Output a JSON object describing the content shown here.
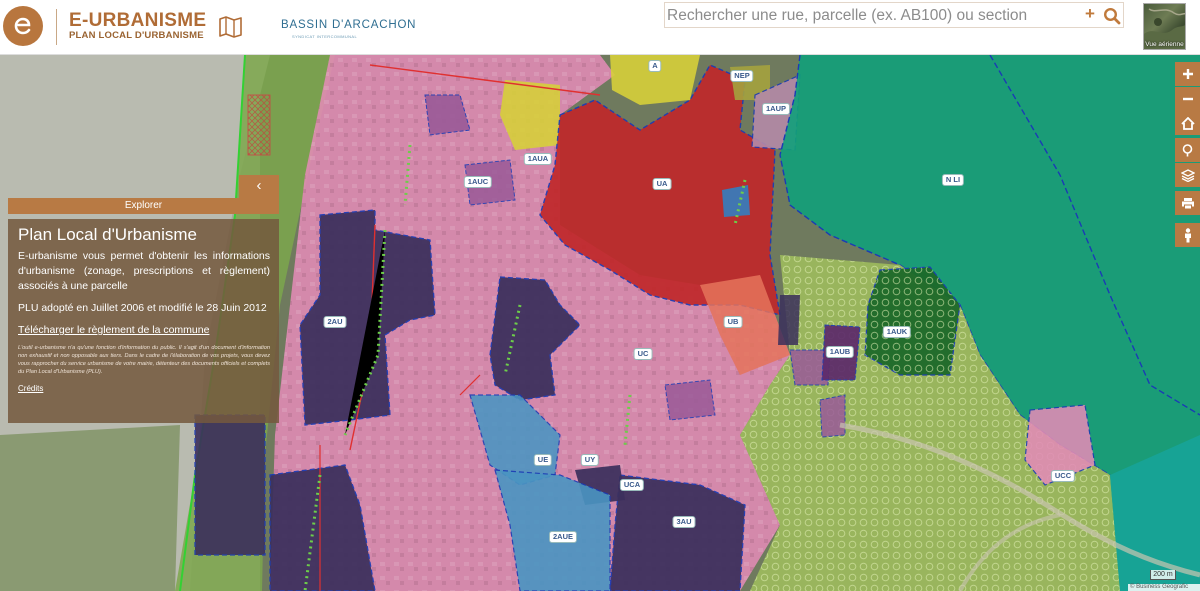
{
  "header": {
    "brand_title": "E-URBANISME",
    "brand_subtitle": "PLAN LOCAL D'URBANISME",
    "partner_name": "BASSIN D'ARCACHON",
    "partner_tagline": "SYNDICAT INTERCOMMUNAL",
    "search_placeholder": "Rechercher une rue, parcelle (ex. AB100) ou section",
    "search_plus": "+",
    "aerial_label": "Vue aérienne"
  },
  "panel": {
    "tab_label": "Explorer",
    "toggle_glyph": "‹",
    "title": "Plan Local d'Urbanisme",
    "description": "E-urbanisme vous permet d'obtenir les informations d'urbanisme (zonage, prescriptions et règlement) associés à une parcelle",
    "dates": "PLU adopté en Juillet 2006 et modifié le 28 Juin 2012",
    "download_link": "Télécharger le règlement de la commune",
    "disclaimer": "L'outil e-urbanisme n'a qu'une fonction d'information du public. Il s'agit d'un document d'information non exhaustif et non opposable aux tiers. Dans le cadre de l'élaboration de vos projets, vous devez vous rapprocher du service urbanisme de votre mairie, détenteur des documents officiels et complets du Plan Local d'Urbanisme (PLU).",
    "credits_link": "Crédits"
  },
  "toolbar": {
    "zoom_in": "+",
    "zoom_out": "−"
  },
  "zones": {
    "a": "A",
    "nep": "NEP",
    "aup1": "1AUP",
    "aua1": "1AUA",
    "auc1": "1AUC",
    "ua": "UA",
    "nli": "N LI",
    "ub": "UB",
    "auk1": "1AUK",
    "aub1": "1AUB",
    "au2": "2AU",
    "uc": "UC",
    "ue": "UE",
    "uy": "UY",
    "uca": "UCA",
    "au3": "3AU",
    "aue2": "2AUE",
    "ucc": "UCC",
    "ul": "UL"
  },
  "footer": {
    "scale_label": "200 m",
    "attribution": "© Business Geografic"
  },
  "colors": {
    "accent": "#b87a44",
    "brand": "#b06c36",
    "zone_uc": "#e28bb6",
    "zone_ua": "#c0282a",
    "zone_n": "#11a07a",
    "zone_au": "#3b2f5c",
    "zone_ue": "#4a95c2",
    "zone_a": "#d6cf3a",
    "zone_agri": "#9dbb5d"
  }
}
